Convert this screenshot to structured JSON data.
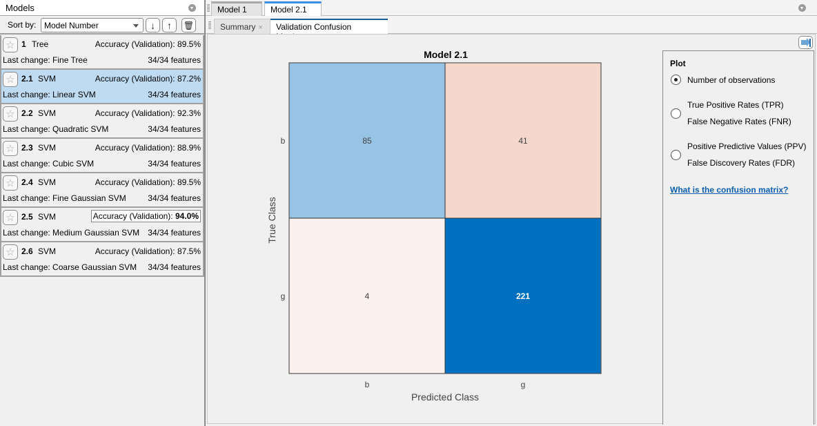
{
  "left_panel": {
    "title": "Models",
    "sort_label": "Sort by:",
    "sort_value": "Model Number",
    "sort_desc_icon": "↓",
    "sort_asc_icon": "↑",
    "delete_icon": "🗑",
    "models": [
      {
        "number": "1",
        "type": "Tree",
        "accuracy_label": "Accuracy (Validation):",
        "accuracy": "89.5%",
        "last_change": "Last change: Fine Tree",
        "features": "34/34 features",
        "selected": false,
        "best": false
      },
      {
        "number": "2.1",
        "type": "SVM",
        "accuracy_label": "Accuracy (Validation):",
        "accuracy": "87.2%",
        "last_change": "Last change: Linear SVM",
        "features": "34/34 features",
        "selected": true,
        "best": false
      },
      {
        "number": "2.2",
        "type": "SVM",
        "accuracy_label": "Accuracy (Validation):",
        "accuracy": "92.3%",
        "last_change": "Last change: Quadratic SVM",
        "features": "34/34 features",
        "selected": false,
        "best": false
      },
      {
        "number": "2.3",
        "type": "SVM",
        "accuracy_label": "Accuracy (Validation):",
        "accuracy": "88.9%",
        "last_change": "Last change: Cubic SVM",
        "features": "34/34 features",
        "selected": false,
        "best": false
      },
      {
        "number": "2.4",
        "type": "SVM",
        "accuracy_label": "Accuracy (Validation):",
        "accuracy": "89.5%",
        "last_change": "Last change: Fine Gaussian SVM",
        "features": "34/34 features",
        "selected": false,
        "best": false
      },
      {
        "number": "2.5",
        "type": "SVM",
        "accuracy_label": "Accuracy (Validation):",
        "accuracy": "94.0%",
        "last_change": "Last change: Medium Gaussian SVM",
        "features": "34/34 features",
        "selected": false,
        "best": true
      },
      {
        "number": "2.6",
        "type": "SVM",
        "accuracy_label": "Accuracy (Validation):",
        "accuracy": "87.5%",
        "last_change": "Last change: Coarse Gaussian SVM",
        "features": "34/34 features",
        "selected": false,
        "best": false
      }
    ]
  },
  "doc_tabs": [
    {
      "label": "Model 1",
      "active": false
    },
    {
      "label": "Model 2.1",
      "active": true
    }
  ],
  "sub_tabs": [
    {
      "label": "Summary",
      "active": false
    },
    {
      "label": "Validation Confusion Matrix",
      "active": true
    }
  ],
  "close_glyph": "×",
  "plot_panel": {
    "title": "Plot",
    "options": [
      {
        "lines": [
          "Number of observations"
        ],
        "selected": true
      },
      {
        "lines": [
          "True Positive Rates (TPR)",
          "False Negative Rates (FNR)"
        ],
        "selected": false
      },
      {
        "lines": [
          "Positive Predictive Values (PPV)",
          "False Discovery Rates (FDR)"
        ],
        "selected": false
      }
    ],
    "link": "What is the confusion matrix?"
  },
  "chart_data": {
    "type": "heatmap",
    "title": "Model 2.1",
    "xlabel": "Predicted Class",
    "ylabel": "True Class",
    "x_categories": [
      "b",
      "g"
    ],
    "y_categories": [
      "b",
      "g"
    ],
    "values": [
      [
        85,
        41
      ],
      [
        4,
        221
      ]
    ],
    "colors": {
      "correct_light": "#97c3e4",
      "correct_dark": "#0070c0",
      "error_light": "#fbf1ef",
      "error_dark": "#f5d8cc"
    },
    "grid": false
  }
}
